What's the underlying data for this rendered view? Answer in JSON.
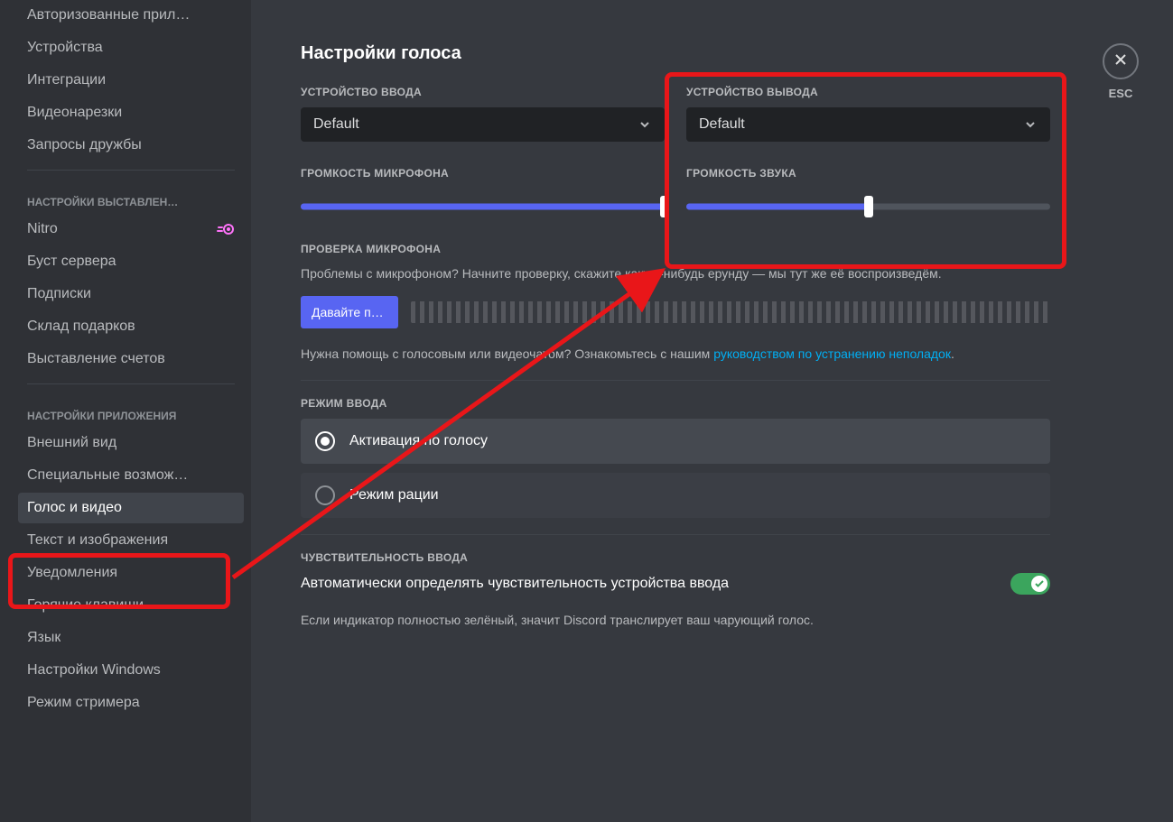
{
  "sidebar": {
    "items_top": [
      "Авторизованные прил…",
      "Устройства",
      "Интеграции",
      "Видеонарезки",
      "Запросы дружбы"
    ],
    "header_billing": "НАСТРОЙКИ ВЫСТАВЛЕН…",
    "items_billing": [
      "Nitro",
      "Буст сервера",
      "Подписки",
      "Склад подарков",
      "Выставление счетов"
    ],
    "header_app": "НАСТРОЙКИ ПРИЛОЖЕНИЯ",
    "items_app": [
      "Внешний вид",
      "Специальные возмож…",
      "Голос и видео",
      "Текст и изображения",
      "Уведомления",
      "Горячие клавиши",
      "Язык",
      "Настройки Windows",
      "Режим стримера"
    ],
    "selected_app_index": 2
  },
  "main": {
    "title": "Настройки голоса",
    "input_device_label": "УСТРОЙСТВО ВВОДА",
    "output_device_label": "УСТРОЙСТВО ВЫВОДА",
    "input_device_value": "Default",
    "output_device_value": "Default",
    "input_volume_label": "ГРОМКОСТЬ МИКРОФОНА",
    "output_volume_label": "ГРОМКОСТЬ ЗВУКА",
    "input_volume_percent": 100,
    "output_volume_percent": 50,
    "mic_test_label": "ПРОВЕРКА МИКРОФОНА",
    "mic_test_desc": "Проблемы с микрофоном? Начните проверку, скажите какую-нибудь ерунду — мы тут же её воспроизведём.",
    "mic_test_button": "Давайте пр…",
    "help_prefix": "Нужна помощь с голосовым или видеочатом? Ознакомьтесь с нашим ",
    "help_link": "руководством по устранению неполадок",
    "help_suffix": ".",
    "input_mode_label": "РЕЖИМ ВВОДА",
    "input_modes": [
      "Активация по голосу",
      "Режим рации"
    ],
    "input_mode_selected": 0,
    "sens_label": "ЧУВСТВИТЕЛЬНОСТЬ ВВОДА",
    "sens_toggle_label": "Автоматически определять чувствительность устройства ввода",
    "sens_toggle_on": true,
    "sens_desc": "Если индикатор полностью зелёный, значит Discord транслирует ваш чарующий голос."
  },
  "close": {
    "esc": "ESC"
  },
  "colors": {
    "accent": "#5865f2",
    "danger": "#e91619",
    "success": "#3ba55d"
  }
}
